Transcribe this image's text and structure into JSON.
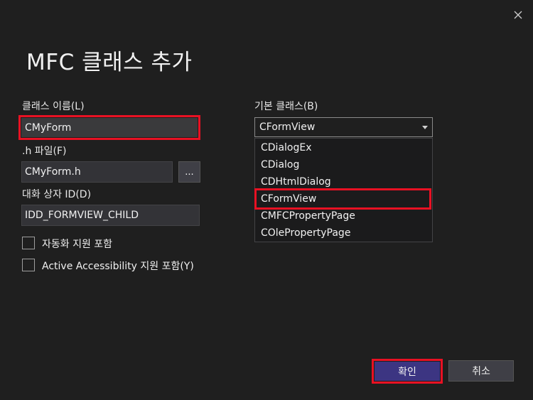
{
  "dialog": {
    "title": "MFC 클래스 추가",
    "close_icon": "close-icon"
  },
  "class_name": {
    "label": "클래스 이름(L)",
    "value": "CMyForm"
  },
  "h_file": {
    "label": ".h 파일(F)",
    "value": "CMyForm.h",
    "browse_label": "..."
  },
  "dialog_id": {
    "label": "대화 상자 ID(D)",
    "value": "IDD_FORMVIEW_CHILD"
  },
  "checkboxes": {
    "automation": "자동화 지원 포함",
    "accessibility": "Active Accessibility 지원 포함(Y)"
  },
  "base_class": {
    "label": "기본 클래스(B)",
    "selected": "CFormView",
    "options": [
      "CDialogEx",
      "CDialog",
      "CDHtmlDialog",
      "CFormView",
      "CMFCPropertyPage",
      "COlePropertyPage"
    ],
    "highlighted_option": "CFormView"
  },
  "buttons": {
    "ok": "확인",
    "cancel": "취소"
  },
  "colors": {
    "highlight": "#e81123",
    "accent": "#4b3c8e",
    "background": "#1f1f1f"
  }
}
